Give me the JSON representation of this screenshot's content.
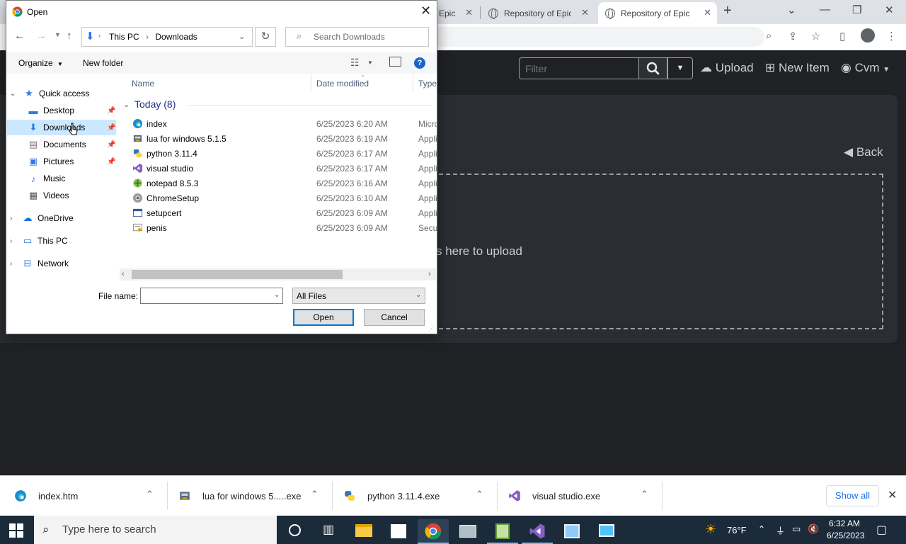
{
  "browser": {
    "tabs": [
      {
        "title": "Epic",
        "close": "✕"
      },
      {
        "title": "Repository of Epic",
        "close": "✕"
      },
      {
        "title": "Repository of Epic",
        "close": "✕"
      }
    ],
    "newtab": "+"
  },
  "site": {
    "filter_placeholder": "Filter",
    "upload_label": "Upload",
    "new_item_label": "New Item",
    "user_label": "Cvm",
    "back_label": "Back",
    "dropzone_text": "s here to upload"
  },
  "dialog": {
    "title": "Open",
    "breadcrumb": [
      "This PC",
      "Downloads"
    ],
    "search_placeholder": "Search Downloads",
    "organize_label": "Organize",
    "new_folder_label": "New folder",
    "nav": {
      "quick_access": "Quick access",
      "desktop": "Desktop",
      "downloads": "Downloads",
      "documents": "Documents",
      "pictures": "Pictures",
      "music": "Music",
      "videos": "Videos",
      "onedrive": "OneDrive",
      "thispc": "This PC",
      "network": "Network"
    },
    "columns": {
      "name": "Name",
      "date": "Date modified",
      "type": "Type"
    },
    "group_header": "Today (8)",
    "files": [
      {
        "name": "index",
        "date": "6/25/2023 6:20 AM",
        "type": "Micro",
        "icon": "edge-icon"
      },
      {
        "name": "lua for windows 5.1.5",
        "date": "6/25/2023 6:19 AM",
        "type": "Appli",
        "icon": "installer-icon"
      },
      {
        "name": "python 3.11.4",
        "date": "6/25/2023 6:17 AM",
        "type": "Appli",
        "icon": "python-icon"
      },
      {
        "name": "visual studio",
        "date": "6/25/2023 6:17 AM",
        "type": "Appli",
        "icon": "visual-studio-icon"
      },
      {
        "name": "notepad  8.5.3",
        "date": "6/25/2023 6:16 AM",
        "type": "Appli",
        "icon": "notepad-plus-icon"
      },
      {
        "name": "ChromeSetup",
        "date": "6/25/2023 6:10 AM",
        "type": "Appli",
        "icon": "chrome-setup-icon"
      },
      {
        "name": "setupcert",
        "date": "6/25/2023 6:09 AM",
        "type": "Appli",
        "icon": "app-window-icon"
      },
      {
        "name": "penis",
        "date": "6/25/2023 6:09 AM",
        "type": "Secur",
        "icon": "certificate-icon"
      }
    ],
    "file_name_label": "File name:",
    "file_name_value": "",
    "file_type": "All Files",
    "open_label": "Open",
    "cancel_label": "Cancel"
  },
  "downloads": {
    "items": [
      {
        "name": "index.htm"
      },
      {
        "name": "lua for windows 5.....exe"
      },
      {
        "name": "python 3.11.4.exe"
      },
      {
        "name": "visual studio.exe"
      }
    ],
    "show_all": "Show all"
  },
  "taskbar": {
    "search_placeholder": "Type here to search",
    "temperature": "76°F",
    "time": "6:32 AM",
    "date": "6/25/2023"
  }
}
